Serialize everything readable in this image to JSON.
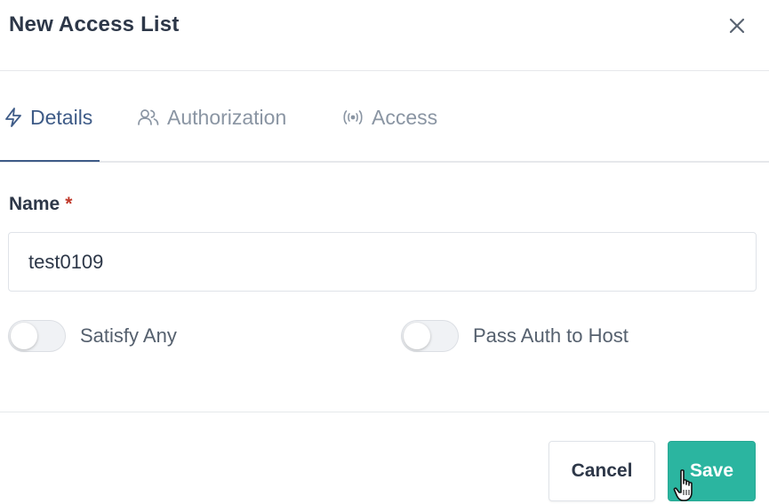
{
  "modal": {
    "title": "New Access List",
    "close_icon": "close-icon"
  },
  "tabs": [
    {
      "label": "Details",
      "icon": "lightning-icon",
      "active": true
    },
    {
      "label": "Authorization",
      "icon": "users-icon",
      "active": false
    },
    {
      "label": "Access",
      "icon": "broadcast-icon",
      "active": false
    }
  ],
  "form": {
    "name_label": "Name",
    "required_mark": "*",
    "name_value": "test0109",
    "satisfy_any": {
      "label": "Satisfy Any",
      "checked": false
    },
    "pass_auth": {
      "label": "Pass Auth to Host",
      "checked": false
    }
  },
  "footer": {
    "cancel_label": "Cancel",
    "save_label": "Save"
  },
  "colors": {
    "accent": "#3e5b87",
    "save": "#2bb5a0",
    "required": "#c0392b"
  }
}
